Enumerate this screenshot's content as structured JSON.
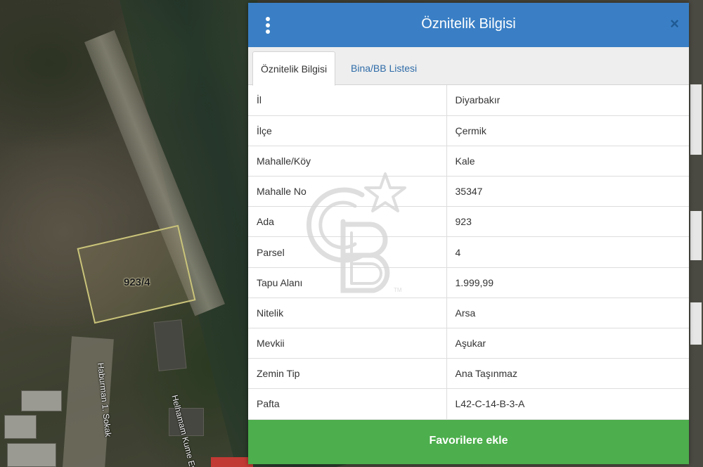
{
  "map": {
    "parcel_label": "923/4",
    "street_1": "Haburman 1. Sokak",
    "street_2": "Helhamam Kume Evleri"
  },
  "dialog": {
    "title": "Öznitelik Bilgisi",
    "menu_icon": "kebab-menu-icon",
    "close_label": "×",
    "tabs": [
      {
        "label": "Öznitelik Bilgisi",
        "active": true
      },
      {
        "label": "Bina/BB Listesi",
        "active": false
      }
    ],
    "rows": [
      {
        "key": "İl",
        "value": "Diyarbakır"
      },
      {
        "key": "İlçe",
        "value": "Çermik"
      },
      {
        "key": "Mahalle/Köy",
        "value": "Kale"
      },
      {
        "key": "Mahalle No",
        "value": "35347"
      },
      {
        "key": "Ada",
        "value": "923"
      },
      {
        "key": "Parsel",
        "value": "4"
      },
      {
        "key": "Tapu Alanı",
        "value": "1.999,99"
      },
      {
        "key": "Nitelik",
        "value": "Arsa"
      },
      {
        "key": "Mevkii",
        "value": "Aşukar"
      },
      {
        "key": "Zemin Tip",
        "value": "Ana Taşınmaz"
      },
      {
        "key": "Pafta",
        "value": "L42-C-14-B-3-A"
      }
    ],
    "favorite_button": "Favorilere ekle"
  },
  "colors": {
    "header": "#3a7fc5",
    "favorite": "#4cae4c",
    "tab_link": "#2f6ca8"
  },
  "watermark": {
    "text": "CB",
    "mark": "TM"
  }
}
